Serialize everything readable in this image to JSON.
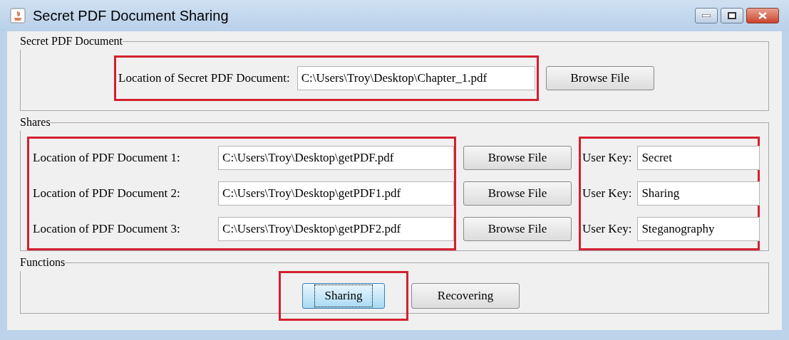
{
  "window": {
    "title": "Secret PDF Document Sharing"
  },
  "secret_section": {
    "title": "Secret PDF Document",
    "label": "Location of Secret PDF Document:",
    "value": "C:\\Users\\Troy\\Desktop\\Chapter_1.pdf",
    "button": "Browse File"
  },
  "shares_section": {
    "title": "Shares",
    "rows": [
      {
        "label": "Location of PDF Document 1:",
        "value": "C:\\Users\\Troy\\Desktop\\getPDF.pdf",
        "button": "Browse File",
        "key_label": "User Key:",
        "key_value": "Secret"
      },
      {
        "label": "Location of PDF Document 2:",
        "value": "C:\\Users\\Troy\\Desktop\\getPDF1.pdf",
        "button": "Browse File",
        "key_label": "User Key:",
        "key_value": "Sharing"
      },
      {
        "label": "Location of PDF Document 3:",
        "value": "C:\\Users\\Troy\\Desktop\\getPDF2.pdf",
        "button": "Browse File",
        "key_label": "User Key:",
        "key_value": "Steganography"
      }
    ]
  },
  "functions_section": {
    "title": "Functions",
    "buttons": [
      {
        "label": "Sharing",
        "focused": true
      },
      {
        "label": "Recovering",
        "focused": false
      }
    ]
  }
}
